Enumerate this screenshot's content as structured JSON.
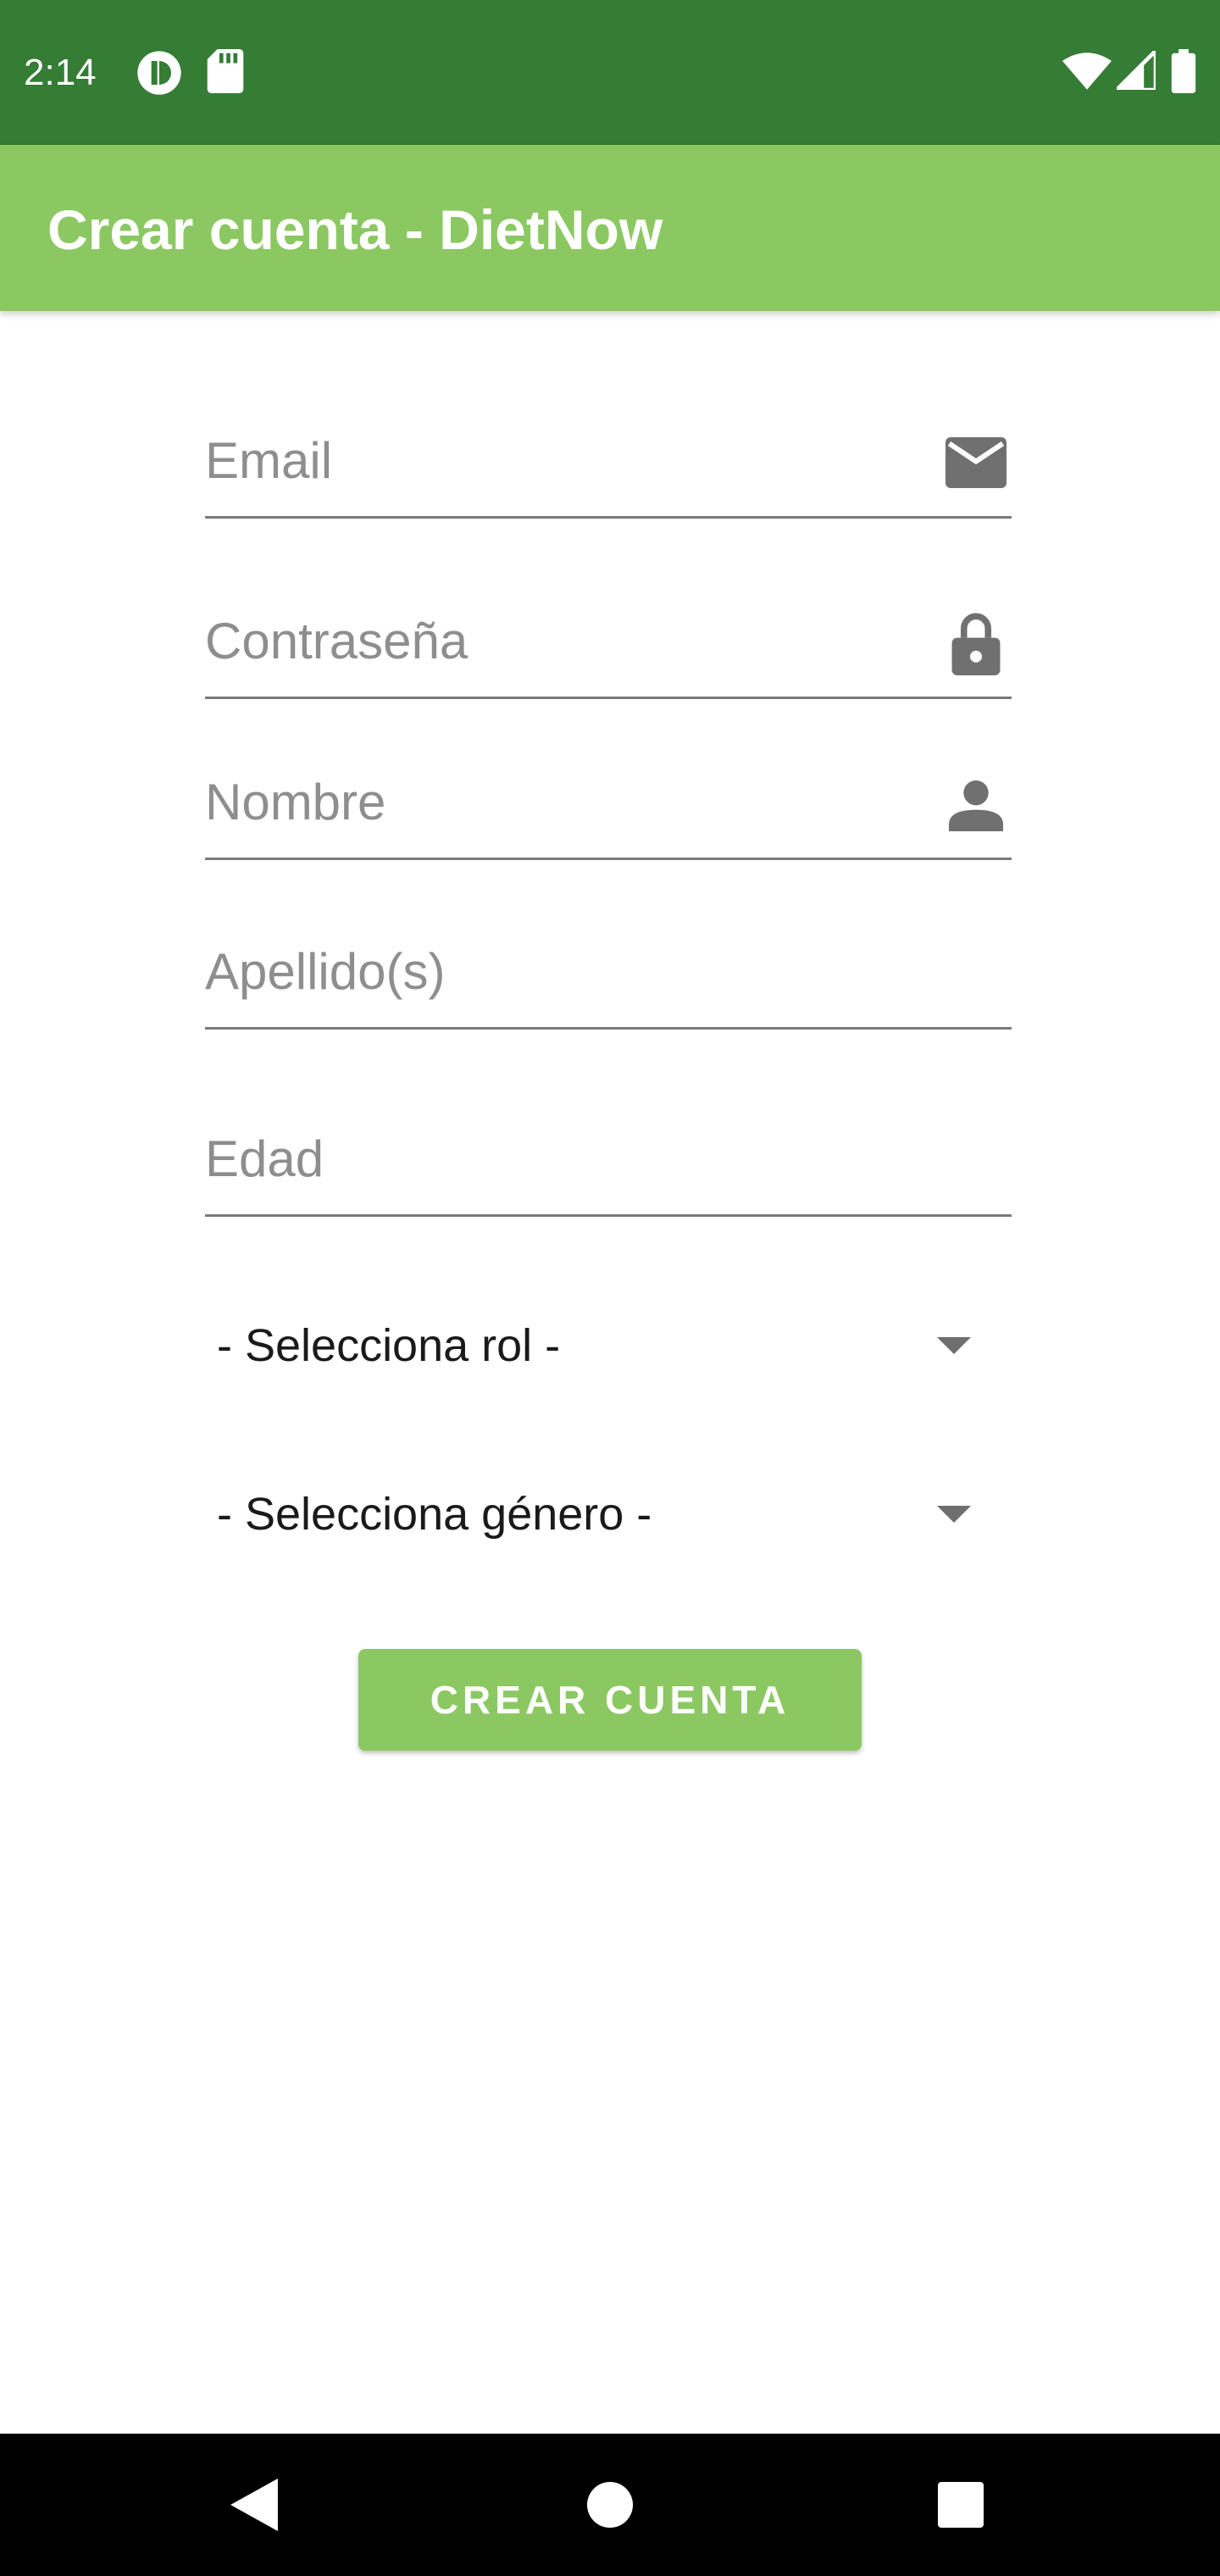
{
  "status_bar": {
    "time": "2:14",
    "icons": [
      "app-notification-icon",
      "sd-card-icon",
      "wifi-icon",
      "signal-icon",
      "battery-icon"
    ],
    "background": "#357c35"
  },
  "app_bar": {
    "title": "Crear cuenta - DietNow",
    "background": "#8bc862"
  },
  "form": {
    "email": {
      "placeholder": "Email",
      "icon": "mail-icon"
    },
    "password": {
      "placeholder": "Contraseña",
      "icon": "lock-icon"
    },
    "first_name": {
      "placeholder": "Nombre",
      "icon": "person-icon"
    },
    "last_name": {
      "placeholder": "Apellido(s)"
    },
    "age": {
      "placeholder": "Edad"
    },
    "role_select": {
      "selected": "- Selecciona rol -"
    },
    "gender_select": {
      "selected": "- Selecciona género -"
    },
    "submit_label": "CREAR CUENTA"
  },
  "nav_bar": {
    "icons": [
      "back-icon",
      "home-icon",
      "recents-icon"
    ]
  }
}
